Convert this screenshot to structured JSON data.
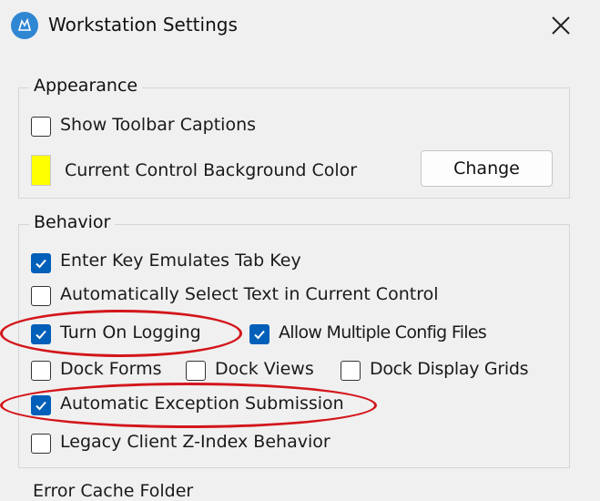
{
  "window": {
    "title": "Workstation Settings",
    "app_icon": "app-logo-icon",
    "close_icon": "close-icon"
  },
  "appearance": {
    "legend": "Appearance",
    "show_toolbar_captions": {
      "label": "Show Toolbar Captions",
      "checked": false
    },
    "current_color_label": "Current Control Background Color",
    "current_color": "#ffff00",
    "change_button": "Change"
  },
  "behavior": {
    "legend": "Behavior",
    "enter_key_tab": {
      "label": "Enter Key Emulates Tab Key",
      "checked": true
    },
    "auto_select_text": {
      "label": "Automatically Select Text in Current Control",
      "checked": false
    },
    "turn_on_logging": {
      "label": "Turn On Logging",
      "checked": true
    },
    "allow_multiple_config": {
      "label": "Allow Multiple Config Files",
      "checked": true
    },
    "dock_forms": {
      "label": "Dock Forms",
      "checked": false
    },
    "dock_views": {
      "label": "Dock Views",
      "checked": false
    },
    "dock_display_grids": {
      "label": "Dock Display Grids",
      "checked": false
    },
    "auto_exception": {
      "label": "Automatic Exception Submission",
      "checked": true
    },
    "legacy_zindex": {
      "label": "Legacy Client Z-Index Behavior",
      "checked": false
    }
  },
  "next_section": {
    "legend": "Error Cache Folder"
  },
  "colors": {
    "checkbox_accent": "#005fb8",
    "annotation": "#d3161b",
    "background": "#f0f0f0"
  }
}
